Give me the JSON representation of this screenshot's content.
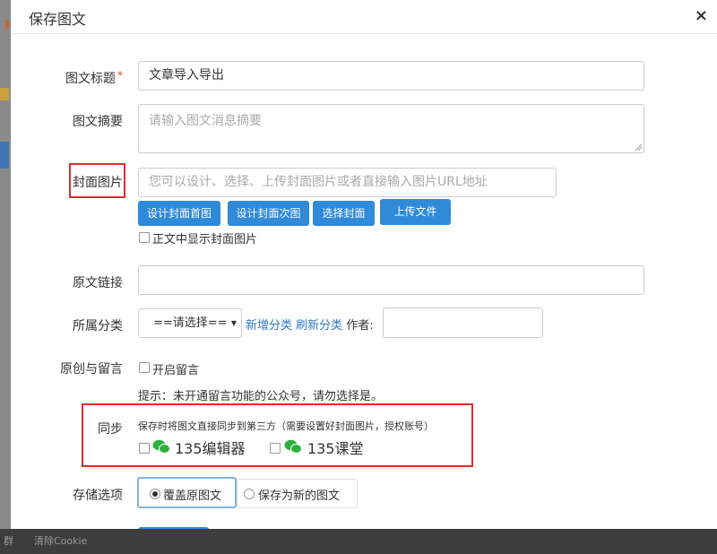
{
  "modal": {
    "title": "保存图文",
    "close_label": "×"
  },
  "form": {
    "title_label": "图文标题",
    "title_required": "*",
    "title_value": "文章导入导出",
    "summary_label": "图文摘要",
    "summary_placeholder": "请输入图文消息摘要",
    "cover_label": "封面图片",
    "cover_placeholder": "您可以设计、选择、上传封面图片或者直接输入图片URL地址",
    "cover_buttons": [
      "设计封面首图",
      "设计封面次图",
      "选择封面",
      "上传文件"
    ],
    "show_cover_label": "正文中显示封面图片",
    "source_label": "原文链接",
    "category_label": "所属分类",
    "category_selected": "==请选择==",
    "new_category_link": "新增分类",
    "refresh_category_link": "刷新分类",
    "author_label": "作者:",
    "original_label": "原创与留言",
    "enable_comment_label": "开启留言",
    "hint_text": "提示：未开通留言功能的公众号，请勿选择是。",
    "sync_label": "同步",
    "sync_desc": "保存时将图文直接同步到第三方（需要设置好封面图片，授权账号）",
    "sync_targets": [
      "135编辑器",
      "135课堂"
    ],
    "storage_label": "存储选项",
    "storage_options": [
      "覆盖原图文",
      "保存为新的图文"
    ],
    "storage_selected": "覆盖原图文"
  },
  "background": {
    "bottom_links": [
      "群",
      "清除Cookie"
    ]
  },
  "colors": {
    "primary_button": "#2f8ad8",
    "link": "#2f78c4",
    "highlight_box": "#e02b2b",
    "wechat_green": "#2bb13e",
    "overlay": "#7a7a7a"
  },
  "icons": {
    "close": "close-icon",
    "sync_target": "wechat-icon"
  }
}
